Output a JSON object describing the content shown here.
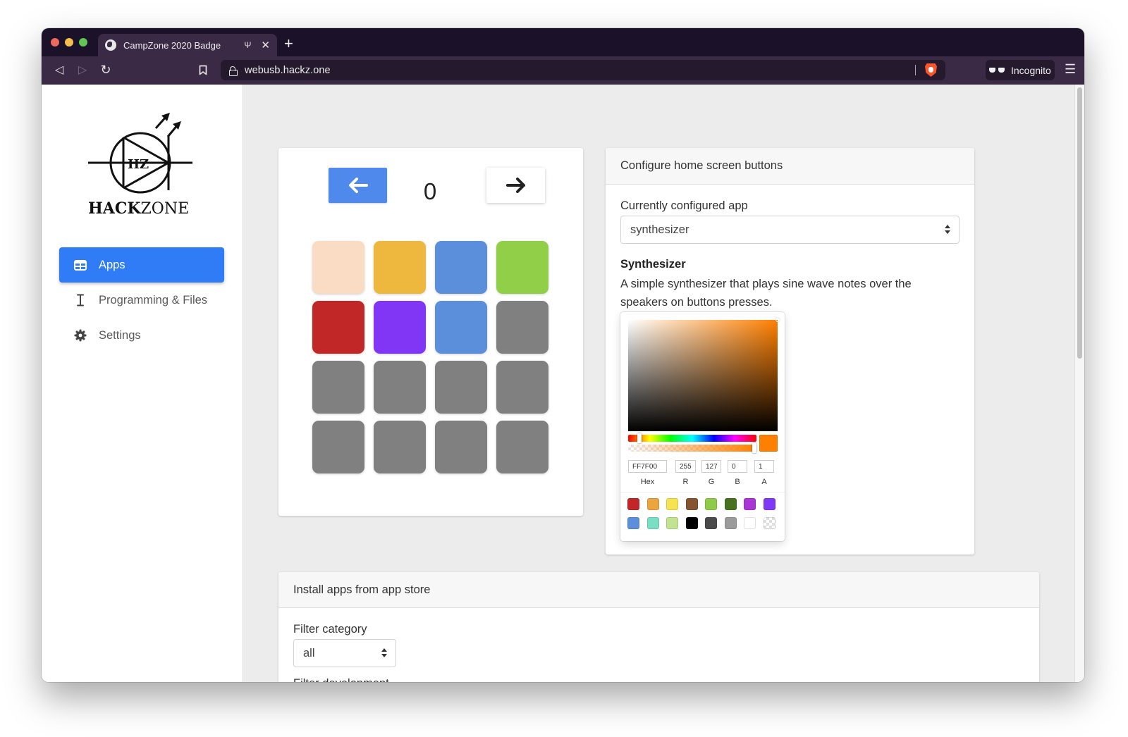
{
  "browser": {
    "tab_title": "CampZone 2020 Badge",
    "tab_usb_indicator": "Ψ",
    "url": "webusb.hackz.one",
    "incognito_label": "Incognito",
    "colors": {
      "titlebar": "#1b1229",
      "toolbar": "#3b2a45"
    }
  },
  "sidebar": {
    "logo": {
      "monogram": "HZ",
      "word_bold": "HACK",
      "word_regular": "ZONE"
    },
    "items": [
      {
        "label": "Apps",
        "icon": "grid-icon",
        "active": true
      },
      {
        "label": "Programming & Files",
        "icon": "cursor-icon",
        "active": false
      },
      {
        "label": "Settings",
        "icon": "gear-icon",
        "active": false
      }
    ],
    "accent": "#2f7cf6"
  },
  "badge": {
    "prev_label": "←",
    "next_label": "→",
    "page_number": "0",
    "tiles": [
      "#fadbc4",
      "#eeb83f",
      "#5b8fdb",
      "#91cf49",
      "#c12726",
      "#8135f5",
      "#5b8fdb",
      "#808080",
      "#808080",
      "#808080",
      "#808080",
      "#808080",
      "#808080",
      "#808080",
      "#808080",
      "#808080"
    ]
  },
  "config": {
    "header": "Configure home screen buttons",
    "app_label": "Currently configured app",
    "app_value": "synthesizer",
    "app_name": "Synthesizer",
    "app_description": "A simple synthesizer that plays sine wave notes over the speakers on buttons presses.",
    "color_picker": {
      "hex": "FF7F00",
      "r": "255",
      "g": "127",
      "b": "0",
      "a": "1",
      "labels": {
        "hex": "Hex",
        "r": "R",
        "g": "G",
        "b": "B",
        "a": "A"
      },
      "current_color": "#ff7f00",
      "presets": [
        "#c12726",
        "#eba540",
        "#f5e34f",
        "#855532",
        "#8fcb4a",
        "#48711f",
        "#a935d6",
        "#8137f6",
        "#5b8fdb",
        "#78dfc3",
        "#c2e390",
        "#000000",
        "#4a4a4a",
        "#9b9b9b",
        "#ffffff",
        "transparent"
      ]
    }
  },
  "store": {
    "header": "Install apps from app store",
    "category_label": "Filter category",
    "category_value": "all",
    "dev_state_label": "Filter development state"
  }
}
